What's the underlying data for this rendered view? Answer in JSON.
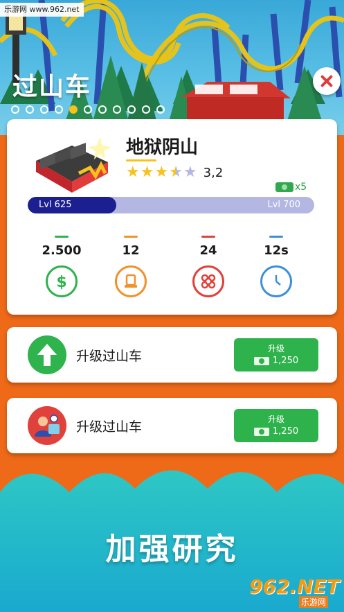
{
  "watermark_top": "乐游网 www.962.net",
  "screen_title": "过山车",
  "pager": {
    "count": 11,
    "active_index": 4
  },
  "ride": {
    "name": "地狱阴山",
    "rating_value": "3,2",
    "rating": 3.2,
    "max_stars": 5,
    "cash_multiplier": "x5",
    "level_current": "Lvl 625",
    "level_next": "Lvl 700",
    "level_progress": 0.31
  },
  "stats": [
    {
      "value": "2.500",
      "icon": "dollar-icon",
      "color": "#2fb34d"
    },
    {
      "value": "12",
      "icon": "seat-icon",
      "color": "#f0922b"
    },
    {
      "value": "24",
      "icon": "crowd-icon",
      "color": "#e0413a"
    },
    {
      "value": "12s",
      "icon": "clock-icon",
      "color": "#3e8fd8"
    }
  ],
  "upgrades": [
    {
      "label": "升级过山车",
      "button_title": "升级",
      "price": "1,250",
      "icon": "arrow-up-icon"
    },
    {
      "label": "升级过山车",
      "button_title": "升级",
      "price": "1,250",
      "icon": "research-worker-icon"
    }
  ],
  "bottom_banner": "加强研究",
  "watermark_bottom": {
    "logo": "962.NET",
    "sub": "乐游网"
  },
  "colors": {
    "orange": "#ee6a18",
    "level_fill": "#1c1f8f",
    "level_track": "#b3b7e2",
    "button_green": "#2eb24b",
    "star_gold": "#f6c21c"
  }
}
